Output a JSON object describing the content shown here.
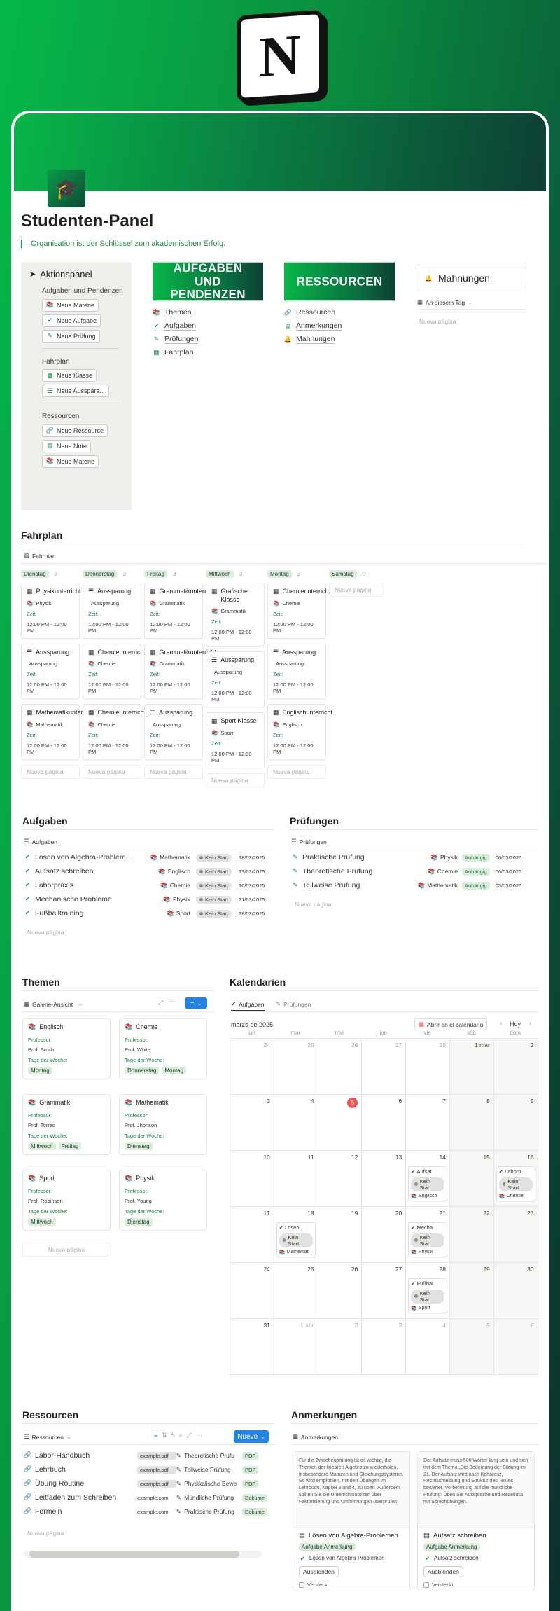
{
  "logo_letter": "N",
  "page": {
    "title": "Studenten-Panel",
    "quote": "Organisation ist der Schlüssel zum akademischen Erfolg."
  },
  "sidebar": {
    "title": "Aktionspanel",
    "g1": "Aufgaben und Pendenzen",
    "g1_buttons": [
      "Neue Materie",
      "Neue Aufgabe",
      "Neue Prüfung"
    ],
    "g2": "Fahrplan",
    "g2_buttons": [
      "Neue Klasse",
      "Neue Ausspara..."
    ],
    "g3": "Ressourcen",
    "g3_buttons": [
      "Neue Ressource",
      "Neue Note",
      "Neue Materie"
    ]
  },
  "banners": {
    "aufgaben": "AUFGABEN UND PENDENZEN",
    "ressourcen": "RESSOURCEN"
  },
  "aufgaben_links": [
    "Themen",
    "Aufgaben",
    "Prüfungen",
    "Fahrplan"
  ],
  "ressourcen_links": [
    "Ressourcen",
    "Anmerkungen",
    "Mahnungen"
  ],
  "mahnungen": {
    "title": "Mahnungen",
    "view": "An diesem Tag",
    "new": "Nueva página"
  },
  "fahrplan": {
    "title": "Fahrplan",
    "view": "Fahrplan",
    "zeit": "Zeit:",
    "new": "Nueva página",
    "columns": [
      {
        "day": "Dienstag",
        "count": "3",
        "cards": [
          {
            "t": "Physikunterricht",
            "s": "Physik",
            "h": "12:00 PM - 12:00 PM"
          },
          {
            "t": "Aussparung",
            "s": "Aussparung",
            "h": "12:00 PM - 12:00 PM"
          },
          {
            "t": "Mathematikunterricht",
            "s": "Mathematik",
            "h": "12:00 PM - 12:00 PM"
          }
        ]
      },
      {
        "day": "Donnerstag",
        "count": "3",
        "cards": [
          {
            "t": "Aussparung",
            "s": "Aussparung",
            "h": "12:00 PM - 12:00 PM"
          },
          {
            "t": "Chemieunterricht",
            "s": "Chemie",
            "h": "12:00 PM - 12:00 PM"
          },
          {
            "t": "Chemieunterricht",
            "s": "Chemie",
            "h": "12:00 PM - 12:00 PM"
          }
        ]
      },
      {
        "day": "Freitag",
        "count": "3",
        "cards": [
          {
            "t": "Grammatikunterricht",
            "s": "Grammatik",
            "h": "12:00 PM - 12:00 PM"
          },
          {
            "t": "Grammatikunterricht",
            "s": "Grammatik",
            "h": "12:00 PM - 12:00 PM"
          },
          {
            "t": "Aussparung",
            "s": "Aussparung",
            "h": "12:00 PM - 12:00 PM"
          }
        ]
      },
      {
        "day": "Mittwoch",
        "count": "3",
        "cards": [
          {
            "t": "Grafische Klasse",
            "s": "Grammatik",
            "h": "12:00 PM - 12:00 PM"
          },
          {
            "t": "Aussparung",
            "s": "Aussparung",
            "h": "12:00 PM - 12:00 PM"
          },
          {
            "t": "Sport Klasse",
            "s": "Sport",
            "h": "12:00 PM - 12:00 PM"
          }
        ]
      },
      {
        "day": "Montag",
        "count": "3",
        "cards": [
          {
            "t": "Chemieunterricht",
            "s": "Chemie",
            "h": "12:00 PM - 12:00 PM"
          },
          {
            "t": "Aussparung",
            "s": "Aussparung",
            "h": "12:00 PM - 12:00 PM"
          },
          {
            "t": "Englischunterricht",
            "s": "Englisch",
            "h": "12:00 PM - 12:00 PM"
          }
        ]
      },
      {
        "day": "Samstag",
        "count": "0",
        "cards": []
      }
    ]
  },
  "aufgaben": {
    "title": "Aufgaben",
    "view": "Aufgaben",
    "new": "Nueva página",
    "rows": [
      {
        "name": "Lösen von Algebra-Problem...",
        "subj": "Mathematik",
        "status": "Kein Start",
        "date": "18/03/2025"
      },
      {
        "name": "Aufsatz schreiben",
        "subj": "Englisch",
        "status": "Kein Start",
        "date": "13/03/2025"
      },
      {
        "name": "Laborpraxis",
        "subj": "Chemie",
        "status": "Kein Start",
        "date": "16/03/2025"
      },
      {
        "name": "Mechanische Probleme",
        "subj": "Physik",
        "status": "Kein Start",
        "date": "21/03/2025"
      },
      {
        "name": "Fußballtraining",
        "subj": "Sport",
        "status": "Kein Start",
        "date": "28/03/2025"
      }
    ]
  },
  "pruefungen": {
    "title": "Prüfungen",
    "view": "Prüfungen",
    "new": "Nueva página",
    "rows": [
      {
        "name": "Praktische Prüfung",
        "subj": "Physik",
        "status": "Anhängig",
        "date": "06/03/2025"
      },
      {
        "name": "Theoretische Prüfung",
        "subj": "Chemie",
        "status": "Anhängig",
        "date": "06/03/2025"
      },
      {
        "name": "Teilweise Prüfung",
        "subj": "Mathematik",
        "status": "Anhängig",
        "date": "03/03/2025"
      }
    ]
  },
  "themen": {
    "title": "Themen",
    "view": "Galerie-Ansicht",
    "new_btn": "+",
    "new": "Nueva página",
    "prof_label": "Professor:",
    "tage_label": "Tage der Woche:",
    "cards": [
      {
        "t": "Englisch",
        "prof": "Prof. Smith",
        "days": [
          "Montag"
        ]
      },
      {
        "t": "Chemie",
        "prof": "Prof. White",
        "days": [
          "Donnerstag",
          "Montag"
        ]
      },
      {
        "t": "Grammatik",
        "prof": "Prof. Torres",
        "days": [
          "Mittwoch",
          "Freitag"
        ]
      },
      {
        "t": "Mathematik",
        "prof": "Prof. Jhonson",
        "days": [
          "Dienstag"
        ]
      },
      {
        "t": "Sport",
        "prof": "Prof. Robinson",
        "days": [
          "Mittwoch"
        ]
      },
      {
        "t": "Physik",
        "prof": "Prof. Young",
        "days": [
          "Dienstag"
        ]
      }
    ]
  },
  "kalendarien": {
    "title": "Kalendarien",
    "tabs": [
      "Aufgaben",
      "Prüfungen"
    ],
    "month": "marzo de 2025",
    "open": "Abrir en el calendario",
    "today": "Hoy",
    "weekdays": [
      "lun",
      "mar",
      "mié",
      "jue",
      "vie",
      "sáb",
      "dom"
    ],
    "days": [
      "24",
      "25",
      "26",
      "27",
      "28",
      "1 mar",
      "2",
      "3",
      "4",
      "5",
      "6",
      "7",
      "8",
      "9",
      "10",
      "11",
      "12",
      "13",
      "14",
      "15",
      "16",
      "17",
      "18",
      "19",
      "20",
      "21",
      "22",
      "23",
      "24",
      "25",
      "26",
      "27",
      "28",
      "29",
      "30",
      "31",
      "1 abr",
      "2",
      "3",
      "4",
      "5",
      "6"
    ],
    "events": [
      {
        "cell": 18,
        "name": "Aufsat...",
        "status": "Kein Start",
        "subj": "Englisch"
      },
      {
        "cell": 20,
        "name": "Laborp...",
        "status": "Kein Start",
        "subj": "Chemie"
      },
      {
        "cell": 22,
        "name": "Lösen ...",
        "status": "Kein Start",
        "subj": "Mathemati"
      },
      {
        "cell": 25,
        "name": "Mecha...",
        "status": "Kein Start",
        "subj": "Physik"
      },
      {
        "cell": 32,
        "name": "Fußbal...",
        "status": "Kein Start",
        "subj": "Sport"
      }
    ]
  },
  "ressourcen": {
    "title": "Ressourcen",
    "view": "Ressourcen",
    "new_btn": "Nuevo",
    "new": "Nueva página",
    "rows": [
      {
        "name": "Labor-Handbuch",
        "file": "example.pdf",
        "note": "Theoretische Prüfu",
        "type": "PDF"
      },
      {
        "name": "Lehrbuch",
        "file": "example.pdf",
        "note": "Teilweise Prüfung",
        "type": "PDF"
      },
      {
        "name": "Übung Routine",
        "file": "example.pdf",
        "note": "Physikalische Bewe",
        "type": "PDF"
      },
      {
        "name": "Leitfaden zum Schreiben",
        "file": "example.com",
        "note": "Mündliche Prüfung",
        "type": "Dokume"
      },
      {
        "name": "Formeln",
        "file": "example.com",
        "note": "Praktische Prüfung",
        "type": "Dokume"
      }
    ]
  },
  "anmerkungen": {
    "title": "Anmerkungen",
    "view": "Anmerkungen",
    "cards": [
      {
        "text": "Für die Zwischenprüfung ist es wichtig, die Themen der linearen Algebra zu wiederholen, insbesondere Matrizen und Gleichungssysteme. Es wird empfohlen, mit den Übungen im Lehrbuch, Kapitel 3 und 4, zu üben. Außerdem sollten Sie die Unterrichtsnotizen über Faktorisierung und Umformungen überprüfen.",
        "title": "Lösen von Algebra-Problemen",
        "tag": "Aufgabe Anmerkung",
        "link": "Lösen von Algebra-Problemen",
        "btn": "Ausblenden",
        "check": "Versteckt"
      },
      {
        "text": "Der Aufsatz muss 500 Wörter lang sein und sich mit dem Thema „Die Bedeutung der Bildung im 21. Der Aufsatz wird nach Kohärenz, Rechtschreibung und Struktur des Textes bewertet. Vorbereitung auf die mündliche Prüfung: Üben Sie Aussprache und Redefluss mit Sprechübungen.",
        "title": "Aufsatz schreiben",
        "tag": "Aufgabe Anmerkung",
        "link": "Aufsatz schreiben",
        "btn": "Ausblenden",
        "check": "Versteckt"
      }
    ]
  }
}
